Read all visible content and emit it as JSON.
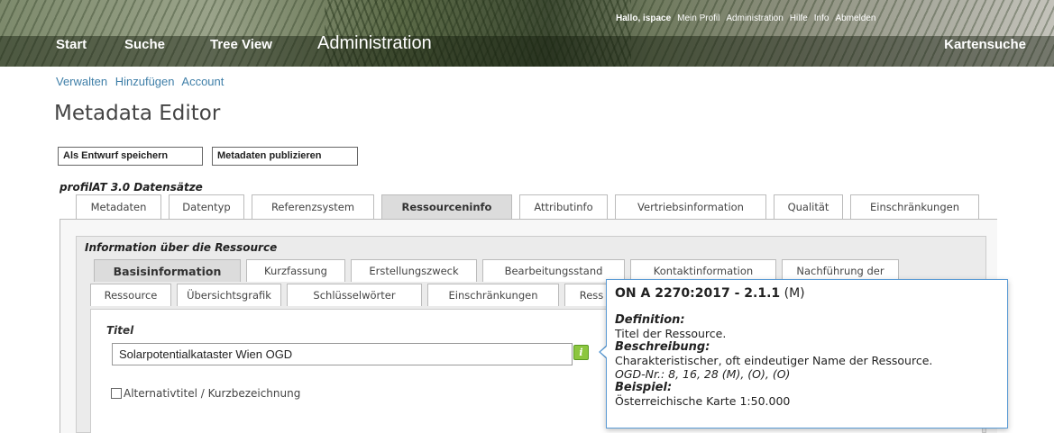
{
  "header": {
    "nav": [
      "Start",
      "Suche",
      "Tree View"
    ],
    "section": "Administration",
    "map_search": "Kartensuche",
    "user_links": {
      "greeting": "Hallo, ispace",
      "profile": "Mein Profil",
      "administration": "Administration",
      "help": "Hilfe",
      "info": "Info",
      "logout": "Abmelden"
    }
  },
  "subnav": [
    "Verwalten",
    "Hinzufügen",
    "Account"
  ],
  "page_title": "Metadata Editor",
  "buttons": {
    "save_draft": "Als Entwurf speichern",
    "publish": "Metadaten publizieren"
  },
  "section_label": "profilAT 3.0 Datensätze",
  "tabs": [
    "Metadaten",
    "Datentyp",
    "Referenzsystem",
    "Ressourceninfo",
    "Attributinfo",
    "Vertriebsinformation",
    "Qualität",
    "Einschränkungen"
  ],
  "active_tab": "Ressourceninfo",
  "inner_section_label": "Information über die Ressource",
  "subtabs_row1": [
    "Basisinformation",
    "Kurzfassung",
    "Erstellungszweck",
    "Bearbeitungsstand",
    "Kontaktinformation",
    "Nachführung der"
  ],
  "subtabs_row2": [
    "Ressource",
    "Übersichtsgrafik",
    "Schlüsselwörter",
    "Einschränkungen",
    "Ress"
  ],
  "active_subtab": "Basisinformation",
  "field": {
    "label": "Titel",
    "value": "Solarpotentialkataster Wien OGD",
    "info_icon_glyph": "i",
    "alt_checkbox_label": "Alternativtitel / Kurzbezeichnung",
    "alt_checked": false
  },
  "tooltip": {
    "standard": "ON A 2270:2017 - 2.1.1",
    "obligation": "(M)",
    "definition_heading": "Definition:",
    "definition": "Titel der Ressource.",
    "description_heading": "Beschreibung:",
    "description": "Charakteristischer, oft eindeutiger Name der Ressource.",
    "ogd": "OGD-Nr.: 8, 16, 28 (M), (O), (O)",
    "example_heading": "Beispiel:",
    "example": "Österreichische Karte 1:50.000"
  },
  "colors": {
    "link": "#3f7fa8",
    "info_icon": "#8cc63f",
    "tooltip_border": "#5a9bd5",
    "active_tab": "#dcdcdc"
  }
}
